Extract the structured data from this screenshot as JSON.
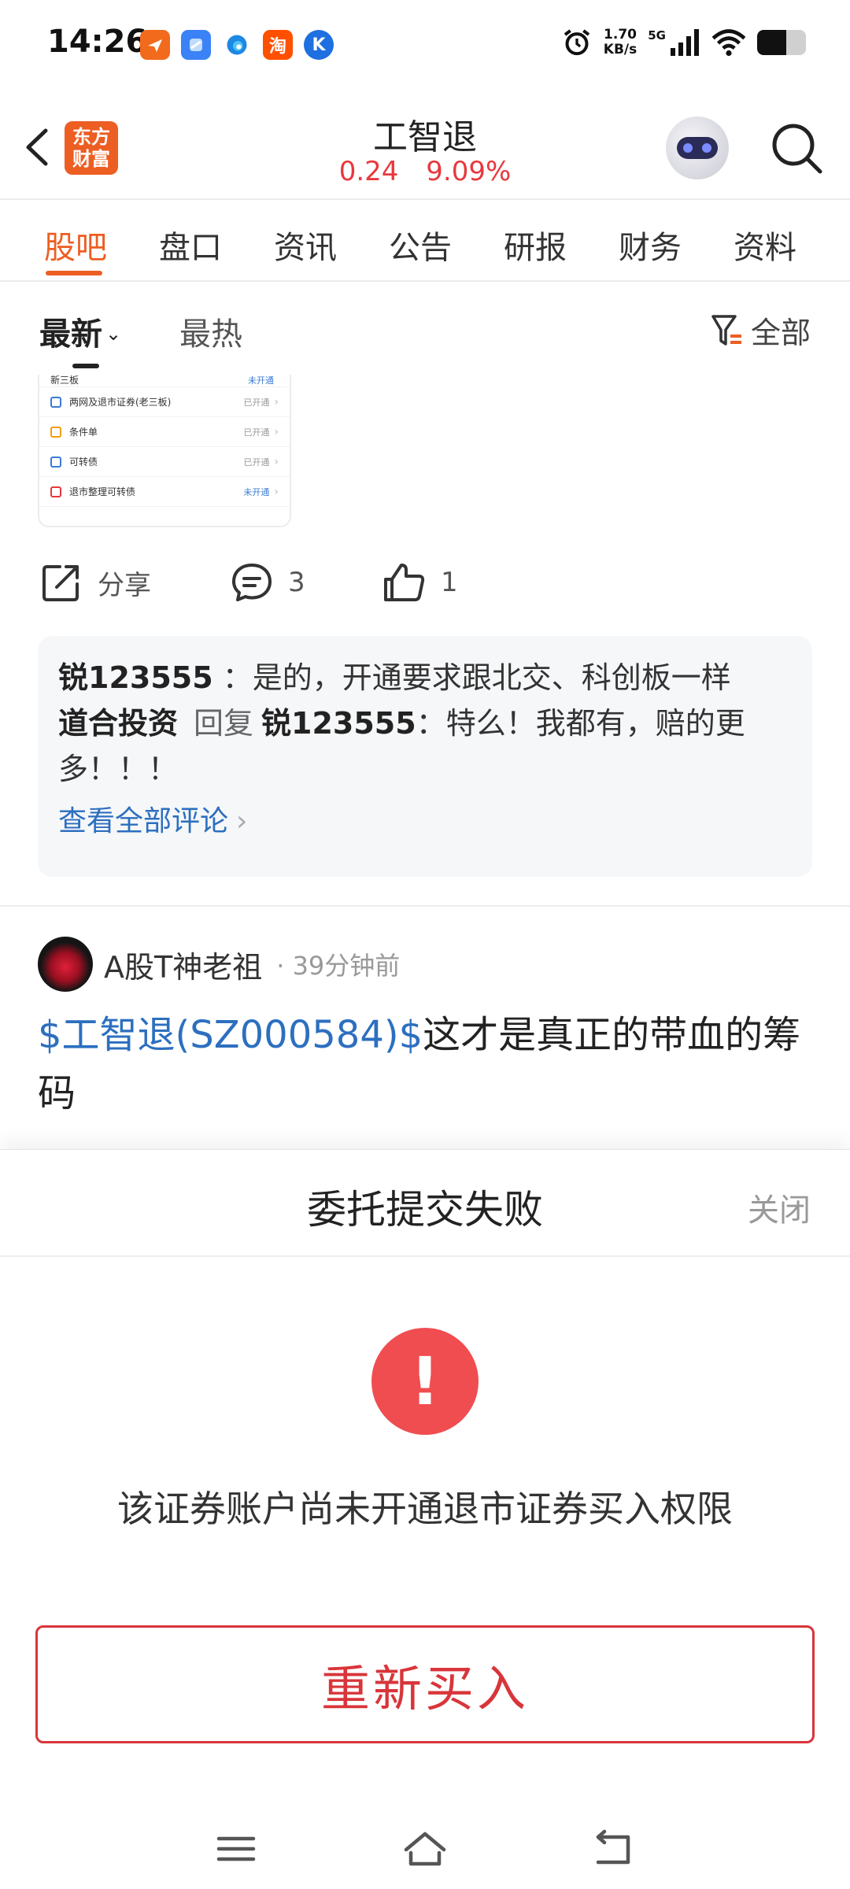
{
  "status_bar": {
    "time": "14:26",
    "app_icons": [
      "flight-app-icon",
      "browser-app-icon",
      "edge-browser-icon",
      "taobao-app-icon",
      "k-app-icon"
    ],
    "taobao_glyph": "淘",
    "k_glyph": "K",
    "net_speed_value": "1.70",
    "net_speed_unit": "KB/s",
    "network": "5G"
  },
  "header": {
    "brand_logo": "东方财富",
    "brand_line1": "东方",
    "brand_line2": "财富",
    "stock_name": "工智退",
    "price": "0.24",
    "change_pct": "9.09%"
  },
  "tabs": [
    {
      "label": "股吧",
      "active": true
    },
    {
      "label": "盘口"
    },
    {
      "label": "资讯"
    },
    {
      "label": "公告"
    },
    {
      "label": "研报"
    },
    {
      "label": "财务"
    },
    {
      "label": "资料"
    }
  ],
  "sort": {
    "latest": "最新",
    "hot": "最热",
    "filter": "全部"
  },
  "post_image": {
    "rows": [
      {
        "name": "新三板",
        "status": "未开通"
      },
      {
        "name": "两网及退市证券(老三板)",
        "status": "已开通"
      },
      {
        "name": "条件单",
        "status": "已开通"
      },
      {
        "name": "可转债",
        "status": "已开通"
      },
      {
        "name": "退市整理可转债",
        "status": "未开通"
      }
    ]
  },
  "actions": {
    "share_label": "分享",
    "comment_count": "3",
    "like_count": "1"
  },
  "comments": {
    "c1_user": "锐123555",
    "c1_text": "：是的，开通要求跟北交、科创板一样",
    "c2_user": "道合投资",
    "c2_reply_word": "回复",
    "c2_target": "锐123555",
    "c2_text": "：特么！我都有，赔的更多！！！",
    "view_all": "查看全部评论"
  },
  "post2": {
    "author": "A股T神老祖",
    "time": "· 39分钟前",
    "stock_link": "$工智退(SZ000584)$",
    "text": "这才是真正的带血的筹码"
  },
  "sheet": {
    "title": "委托提交失败",
    "close": "关闭",
    "error_glyph": "!",
    "message": "该证券账户尚未开通退市证券买入权限",
    "rebuy_button": "重新买入"
  },
  "colors": {
    "brand_orange": "#ec5e22",
    "quote_red": "#e8383d",
    "link_blue": "#2c6fbf",
    "error_red": "#f04d51",
    "button_red": "#d8353a"
  }
}
